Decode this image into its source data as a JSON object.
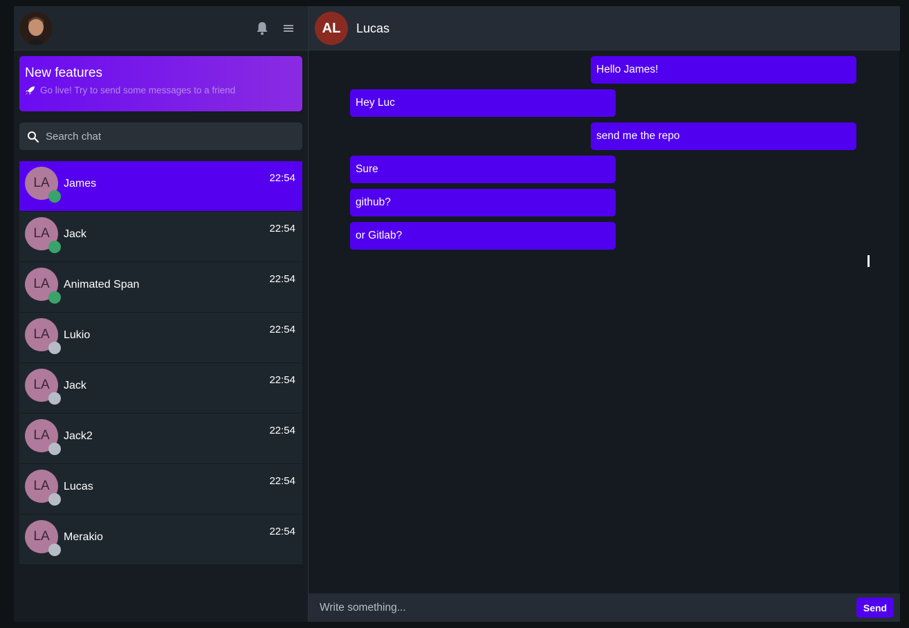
{
  "sidebar": {
    "promo": {
      "title": "New features",
      "subtitle": "Go live! Try to send some messages to a friend",
      "icon": "rocket-icon"
    },
    "search": {
      "placeholder": "Search chat"
    },
    "chats": [
      {
        "initials": "LA",
        "name": "James",
        "time": "22:54",
        "online": true,
        "active": true
      },
      {
        "initials": "LA",
        "name": "Jack",
        "time": "22:54",
        "online": true,
        "active": false
      },
      {
        "initials": "LA",
        "name": "Animated Span",
        "time": "22:54",
        "online": true,
        "active": false
      },
      {
        "initials": "LA",
        "name": "Lukio",
        "time": "22:54",
        "online": false,
        "active": false
      },
      {
        "initials": "LA",
        "name": "Jack",
        "time": "22:54",
        "online": false,
        "active": false
      },
      {
        "initials": "LA",
        "name": "Jack2",
        "time": "22:54",
        "online": false,
        "active": false
      },
      {
        "initials": "LA",
        "name": "Lucas",
        "time": "22:54",
        "online": false,
        "active": false
      },
      {
        "initials": "LA",
        "name": "Merakio",
        "time": "22:54",
        "online": false,
        "active": false
      }
    ]
  },
  "conversation": {
    "contact_initials": "AL",
    "contact_name": "Lucas",
    "messages": [
      {
        "text": "Hello James!",
        "direction": "out"
      },
      {
        "text": "Hey Luc",
        "direction": "in"
      },
      {
        "text": "send me the repo",
        "direction": "out"
      },
      {
        "text": "Sure",
        "direction": "in"
      },
      {
        "text": "github?",
        "direction": "in"
      },
      {
        "text": "or Gitlab?",
        "direction": "in"
      }
    ]
  },
  "composer": {
    "placeholder": "Write something...",
    "send_label": "Send"
  },
  "colors": {
    "accent": "#5000ee",
    "online": "#3aa36a",
    "offline": "#b6bcc6",
    "avatar": "#b07a9c"
  }
}
